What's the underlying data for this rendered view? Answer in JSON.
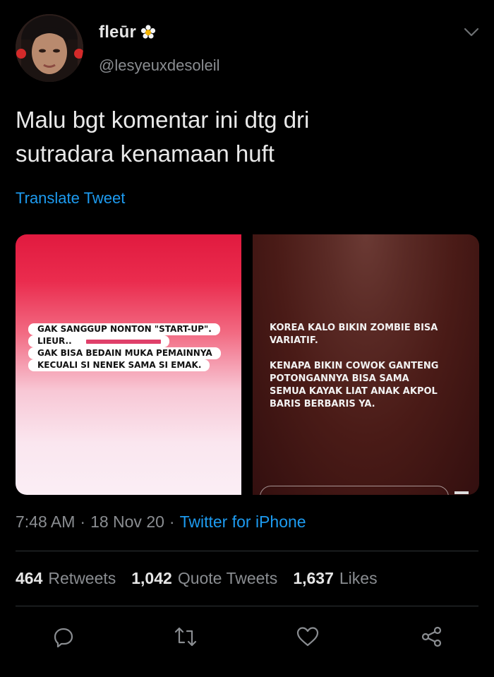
{
  "author": {
    "display_name": "fleūr",
    "badge_icon": "flower-icon",
    "handle": "@lesyeuxdesoleil"
  },
  "tweet": {
    "text": "Malu bgt komentar ini dtg dri\nsutradara kenamaan huft",
    "translate_label": "Translate Tweet"
  },
  "media": {
    "left_story": {
      "lines": [
        "GAK SANGGUP NONTON \"START-UP\".",
        "LIEUR..",
        "GAK BISA BEDAIN MUKA PEMAINNYA",
        "KECUALI SI NENEK SAMA SI EMAK."
      ]
    },
    "right_story": {
      "paragraphs": [
        "KOREA KALO BIKIN ZOMBIE BISA\nVARIATIF.",
        "KENAPA BIKIN COWOK GANTENG\nPOTONGANNYA BISA SAMA\nSEMUA KAYAK LIAT ANAK AKPOL\nBARIS BERBARIS YA."
      ]
    }
  },
  "meta": {
    "time": "7:48 AM",
    "date": "18 Nov 20",
    "separator": "·",
    "source": "Twitter for iPhone"
  },
  "stats": {
    "retweets": {
      "count": "464",
      "label": "Retweets"
    },
    "quotes": {
      "count": "1,042",
      "label": "Quote Tweets"
    },
    "likes": {
      "count": "1,637",
      "label": "Likes"
    }
  },
  "actions": [
    "reply-icon",
    "retweet-icon",
    "like-icon",
    "share-icon"
  ],
  "colors": {
    "background": "#000000",
    "accent": "#1d9bf0",
    "secondary_text": "#8a8d91",
    "primary_text": "#e6e6e6"
  }
}
